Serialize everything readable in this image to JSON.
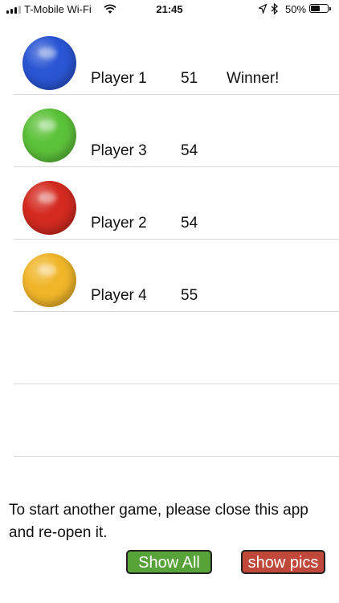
{
  "status_bar": {
    "carrier": "T-Mobile Wi-Fi",
    "time": "21:45",
    "battery_percent": "50%",
    "battery_level": 0.5
  },
  "scores": [
    {
      "name": "Player 1",
      "score": "51",
      "note": "Winner!",
      "ball_color": "#2a56d4"
    },
    {
      "name": "Player 3",
      "score": "54",
      "note": "",
      "ball_color": "#5cc23a"
    },
    {
      "name": "Player 2",
      "score": "54",
      "note": "",
      "ball_color": "#d42a20"
    },
    {
      "name": "Player 4",
      "score": "55",
      "note": "",
      "ball_color": "#f0b62a"
    }
  ],
  "message": "To start another game, please close this app and re-open it.",
  "buttons": {
    "show_all": {
      "label": "Show All",
      "color": "#58a23a"
    },
    "show_pics": {
      "label": "show pics",
      "color": "#c0483a"
    }
  }
}
